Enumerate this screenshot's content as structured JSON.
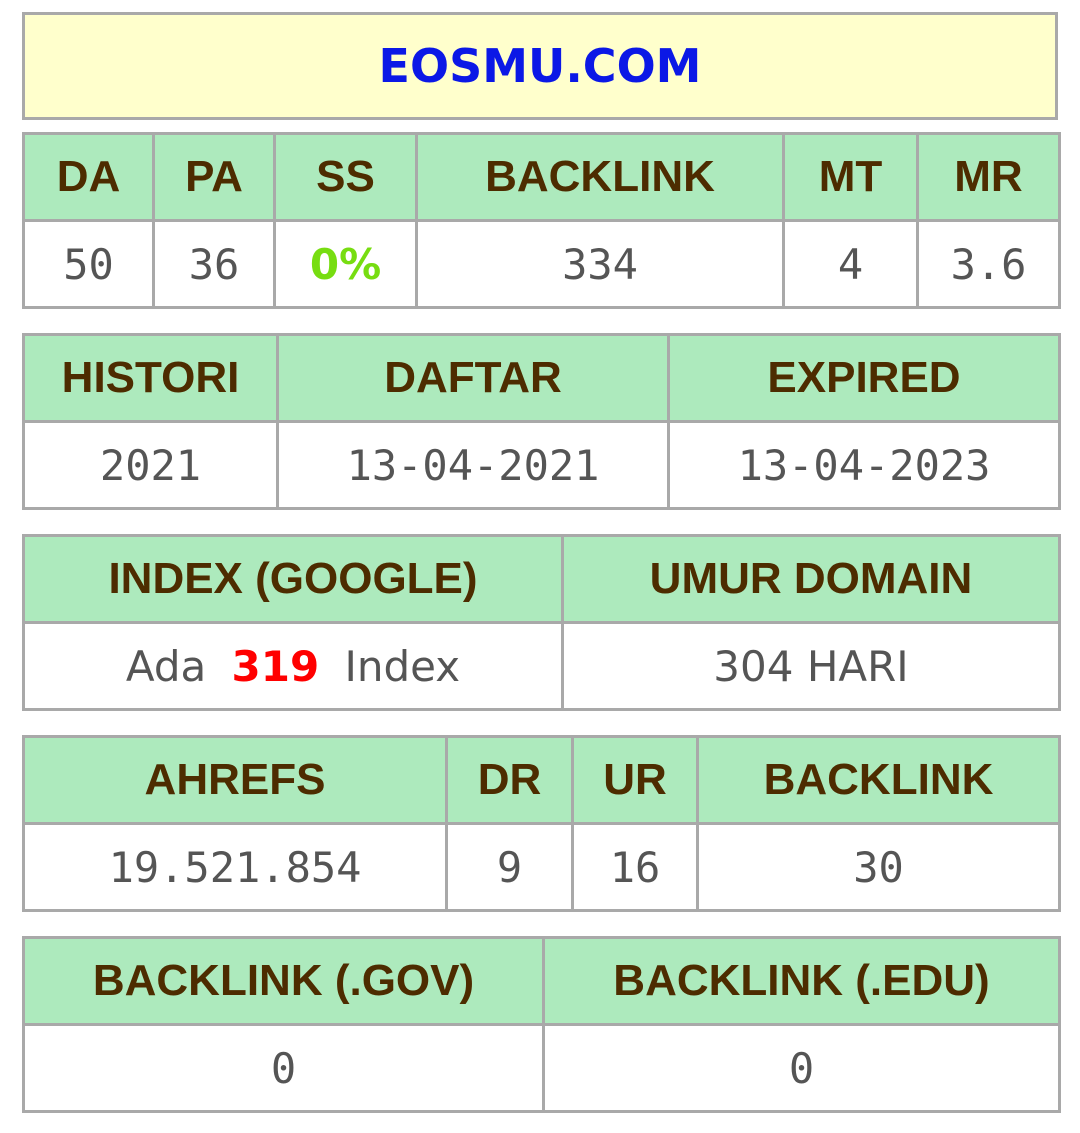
{
  "site": {
    "title": "EOSMU.COM",
    "title_color": "#0b18e6"
  },
  "moz": {
    "headers": [
      "DA",
      "PA",
      "SS",
      "BACKLINK",
      "MT",
      "MR"
    ],
    "values": {
      "da": "50",
      "pa": "36",
      "ss": "0%",
      "backlink": "334",
      "mt": "4",
      "mr": "3.6"
    }
  },
  "domain": {
    "headers": [
      "HISTORI",
      "DAFTAR",
      "EXPIRED"
    ],
    "values": {
      "histori": "2021",
      "daftar": "13-04-2021",
      "expired": "13-04-2023"
    }
  },
  "index": {
    "headers": [
      "INDEX (GOOGLE)",
      "UMUR DOMAIN"
    ],
    "index_prefix": "Ada",
    "index_count": "319",
    "index_suffix": "Index",
    "umur": "304 HARI"
  },
  "ahrefs": {
    "headers": [
      "AHREFS",
      "DR",
      "UR",
      "BACKLINK"
    ],
    "values": {
      "rank": "19.521.854",
      "dr": "9",
      "ur": "16",
      "backlink": "30"
    }
  },
  "special": {
    "headers": [
      "BACKLINK (.GOV)",
      "BACKLINK (.EDU)"
    ],
    "values": {
      "gov": "0",
      "edu": "0"
    }
  },
  "colors": {
    "header_bg": "#adeabd",
    "header_text": "#4d2c00",
    "value_text": "#555555",
    "ss_green": "#77dd11",
    "index_red": "#ff0000",
    "title_bg": "#ffffcc",
    "border": "#a9a9a9"
  }
}
